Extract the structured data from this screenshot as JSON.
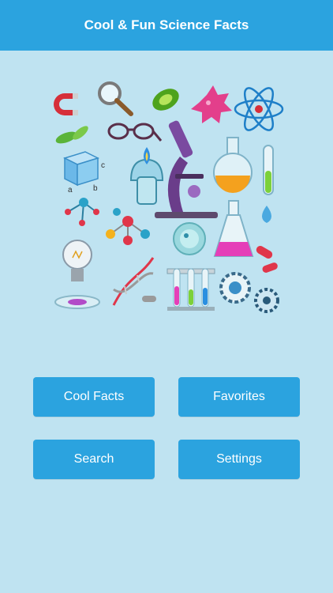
{
  "app": {
    "title": "Cool & Fun Science Facts"
  },
  "colors": {
    "header_bg": "#2ba3df",
    "page_bg": "#bfe3f1",
    "button_bg": "#2ba3df",
    "button_text": "#ffffff"
  },
  "illustration": {
    "icons": [
      "magnet-icon",
      "magnifying-glass-icon",
      "virus-icon",
      "bacteria-icon",
      "atom-icon",
      "leaf-icon",
      "glasses-icon",
      "ice-cube-icon",
      "burner-icon",
      "microscope-icon",
      "round-flask-icon",
      "test-tube-icon",
      "molecule-icon",
      "dna-icon",
      "petri-dish-icon",
      "erlenmeyer-flask-icon",
      "water-drop-icon",
      "pill-icon",
      "light-bulb-icon",
      "gear-icon"
    ],
    "labels": {
      "cube_c": "c",
      "cube_a": "a",
      "cube_b": "b"
    }
  },
  "menu": {
    "cool_facts": "Cool Facts",
    "favorites": "Favorites",
    "search": "Search",
    "settings": "Settings"
  }
}
